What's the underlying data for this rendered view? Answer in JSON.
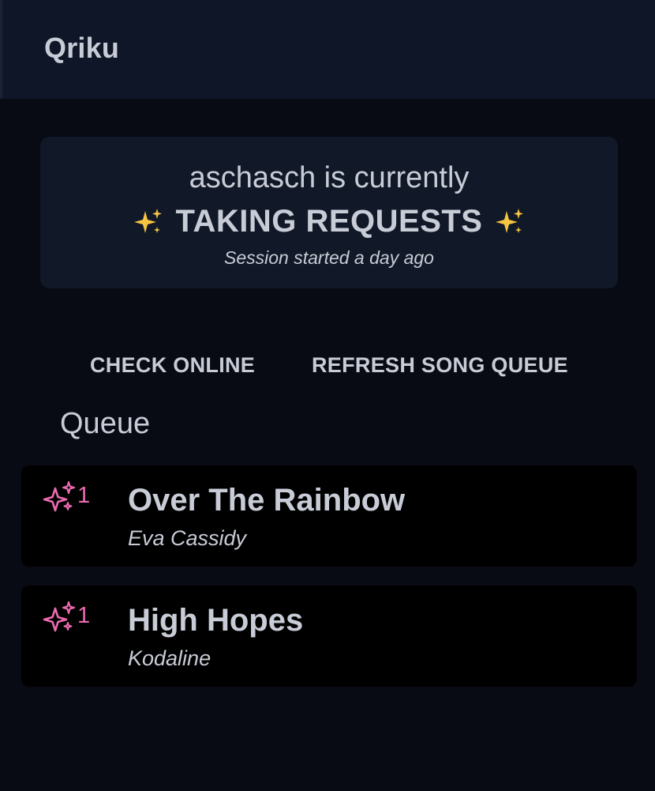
{
  "header": {
    "app_title": "Qriku"
  },
  "status": {
    "line1": "aschasch is currently",
    "line2": "TAKING REQUESTS",
    "line3": "Session started a day ago",
    "emoji_icon": "sparkles-icon"
  },
  "actions": {
    "check_online": "CHECK ONLINE",
    "refresh_queue": "REFRESH SONG QUEUE"
  },
  "queue": {
    "heading": "Queue",
    "items": [
      {
        "boost_count": "1",
        "title": "Over The Rainbow",
        "artist": "Eva Cassidy"
      },
      {
        "boost_count": "1",
        "title": "High Hopes",
        "artist": "Kodaline"
      }
    ]
  },
  "colors": {
    "background": "#080b14",
    "header": "#0f1628",
    "card": "#111827",
    "text": "#c8ccd6",
    "boost_accent": "#ec6bb0",
    "emoji_gold": "#f5c542"
  }
}
